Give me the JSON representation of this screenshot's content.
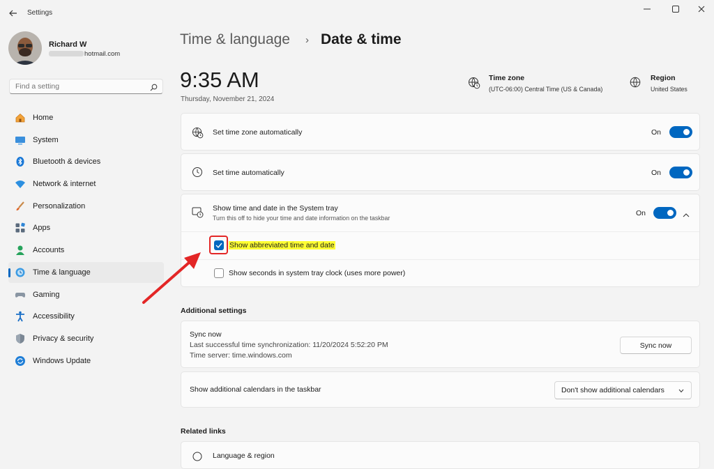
{
  "window": {
    "title": "Settings",
    "controls": [
      "minimize",
      "maximize",
      "close"
    ]
  },
  "profile": {
    "name": "Richard W",
    "email": "hotmail.com"
  },
  "search": {
    "placeholder": "Find a setting"
  },
  "sidebar": {
    "selected": "Time & language",
    "items": [
      {
        "label": "Home",
        "icon": "home-icon"
      },
      {
        "label": "System",
        "icon": "system-icon"
      },
      {
        "label": "Bluetooth & devices",
        "icon": "bluetooth-icon"
      },
      {
        "label": "Network & internet",
        "icon": "wifi-icon"
      },
      {
        "label": "Personalization",
        "icon": "brush-icon"
      },
      {
        "label": "Apps",
        "icon": "apps-icon"
      },
      {
        "label": "Accounts",
        "icon": "accounts-icon"
      },
      {
        "label": "Time & language",
        "icon": "globe-clock-icon"
      },
      {
        "label": "Gaming",
        "icon": "gamepad-icon"
      },
      {
        "label": "Accessibility",
        "icon": "accessibility-icon"
      },
      {
        "label": "Privacy & security",
        "icon": "shield-icon"
      },
      {
        "label": "Windows Update",
        "icon": "update-icon"
      }
    ]
  },
  "breadcrumb": {
    "parent": "Time & language",
    "separator": "›",
    "current": "Date & time"
  },
  "clock": {
    "time": "9:35 AM",
    "date": "Thursday, November 21, 2024"
  },
  "time_zone": {
    "title": "Time zone",
    "value": "(UTC-06:00) Central Time (US & Canada)"
  },
  "region": {
    "title": "Region",
    "value": "United States"
  },
  "settings": {
    "tz_auto": {
      "label": "Set time zone automatically",
      "state": "On"
    },
    "time_auto": {
      "label": "Set time automatically",
      "state": "On"
    },
    "tray": {
      "label": "Show time and date in the System tray",
      "sub": "Turn this off to hide your time and date information on the taskbar",
      "state": "On"
    },
    "abbrev": {
      "label": "Show abbreviated time and date",
      "checked": true
    },
    "seconds": {
      "label": "Show seconds in system tray clock (uses more power)",
      "checked": false
    }
  },
  "additional": {
    "title": "Additional settings",
    "sync": {
      "title": "Sync now",
      "last": "Last successful time synchronization: 11/20/2024 5:52:20 PM",
      "server": "Time server: time.windows.com",
      "button": "Sync now"
    },
    "calendars": {
      "label": "Show additional calendars in the taskbar",
      "selected": "Don't show additional calendars"
    }
  },
  "related": {
    "title": "Related links",
    "first_item": "Language & region"
  },
  "colors": {
    "accent": "#0067c0",
    "annotation_red": "#e32626",
    "highlight_yellow": "#ffff33"
  }
}
